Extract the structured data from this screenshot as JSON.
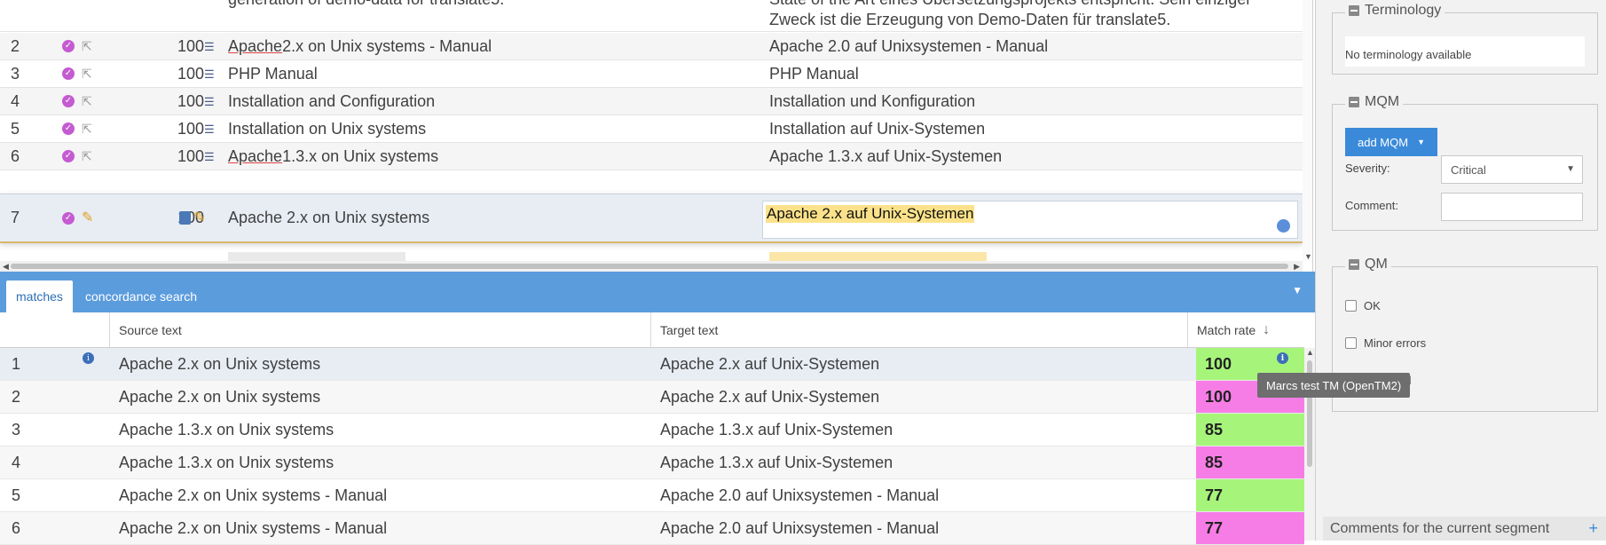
{
  "segments": {
    "partial_row": {
      "source": "generation of demo-data for translate5.",
      "target": "State of the Art eines Übersetzungsprojekts entspricht. Sein einziger Zweck ist die Erzeugung von Demo-Daten für translate5."
    },
    "rows": [
      {
        "num": "2",
        "match": "100",
        "source_pre": "Apache",
        "source_post": " 2.x on Unix systems - Manual",
        "target": "Apache 2.0 auf Unixsystemen - Manual"
      },
      {
        "num": "3",
        "match": "100",
        "source_pre": "",
        "source_post": "PHP Manual",
        "target": "PHP Manual"
      },
      {
        "num": "4",
        "match": "100",
        "source_pre": "",
        "source_post": "Installation and Configuration",
        "target": "Installation und Konfiguration"
      },
      {
        "num": "5",
        "match": "100",
        "source_pre": "",
        "source_post": "Installation on Unix systems",
        "target": "Installation auf Unix-Systemen"
      },
      {
        "num": "6",
        "match": "100",
        "source_pre": "Apache",
        "source_post": " 1.3.x on Unix systems",
        "target": "Apache 1.3.x auf Unix-Systemen"
      }
    ],
    "editing": {
      "num": "7",
      "match": "100",
      "source": "Apache 2.x on Unix systems",
      "target": "Apache 2.x auf Unix-Systemen"
    }
  },
  "matches_panel": {
    "tabs": [
      {
        "label": "matches"
      },
      {
        "label": "concordance search"
      }
    ],
    "columns": {
      "source": "Source text",
      "target": "Target text",
      "rate": "Match rate"
    },
    "rows": [
      {
        "num": "1",
        "source": "Apache 2.x on Unix systems",
        "target": "Apache 2.x auf Unix-Systemen",
        "rate": "100",
        "color": "#a6f57a"
      },
      {
        "num": "2",
        "source": "Apache 2.x on Unix systems",
        "target": "Apache 2.x auf Unix-Systemen",
        "rate": "100",
        "color": "#f77de6"
      },
      {
        "num": "3",
        "source": "Apache 1.3.x on Unix systems",
        "target": "Apache 1.3.x auf Unix-Systemen",
        "rate": "85",
        "color": "#a6f57a"
      },
      {
        "num": "4",
        "source": "Apache 1.3.x on Unix systems",
        "target": "Apache 1.3.x auf Unix-Systemen",
        "rate": "85",
        "color": "#f77de6"
      },
      {
        "num": "5",
        "source": "Apache 2.x on Unix systems - Manual",
        "target": "Apache 2.0 auf Unixsystemen - Manual",
        "rate": "77",
        "color": "#a6f57a"
      },
      {
        "num": "6",
        "source": "Apache 2.x on Unix systems - Manual",
        "target": "Apache 2.0 auf Unixsystemen - Manual",
        "rate": "77",
        "color": "#f77de6"
      }
    ],
    "tooltip": "Marcs test TM (OpenTM2)"
  },
  "sidebar": {
    "terminology": {
      "title": "Terminology",
      "message": "No terminology available"
    },
    "mqm": {
      "title": "MQM",
      "add_button": "add MQM",
      "severity_label": "Severity:",
      "severity_value": "Critical",
      "comment_label": "Comment:",
      "comment_value": ""
    },
    "qm": {
      "title": "QM",
      "options": [
        "OK",
        "Minor errors",
        "reworked"
      ]
    },
    "comments_title": "Comments for the current segment"
  },
  "colors": {
    "accent": "#5b9cdd",
    "match_green": "#a6f57a",
    "match_pink": "#f77de6",
    "editor_highlight": "#fbe28a"
  }
}
